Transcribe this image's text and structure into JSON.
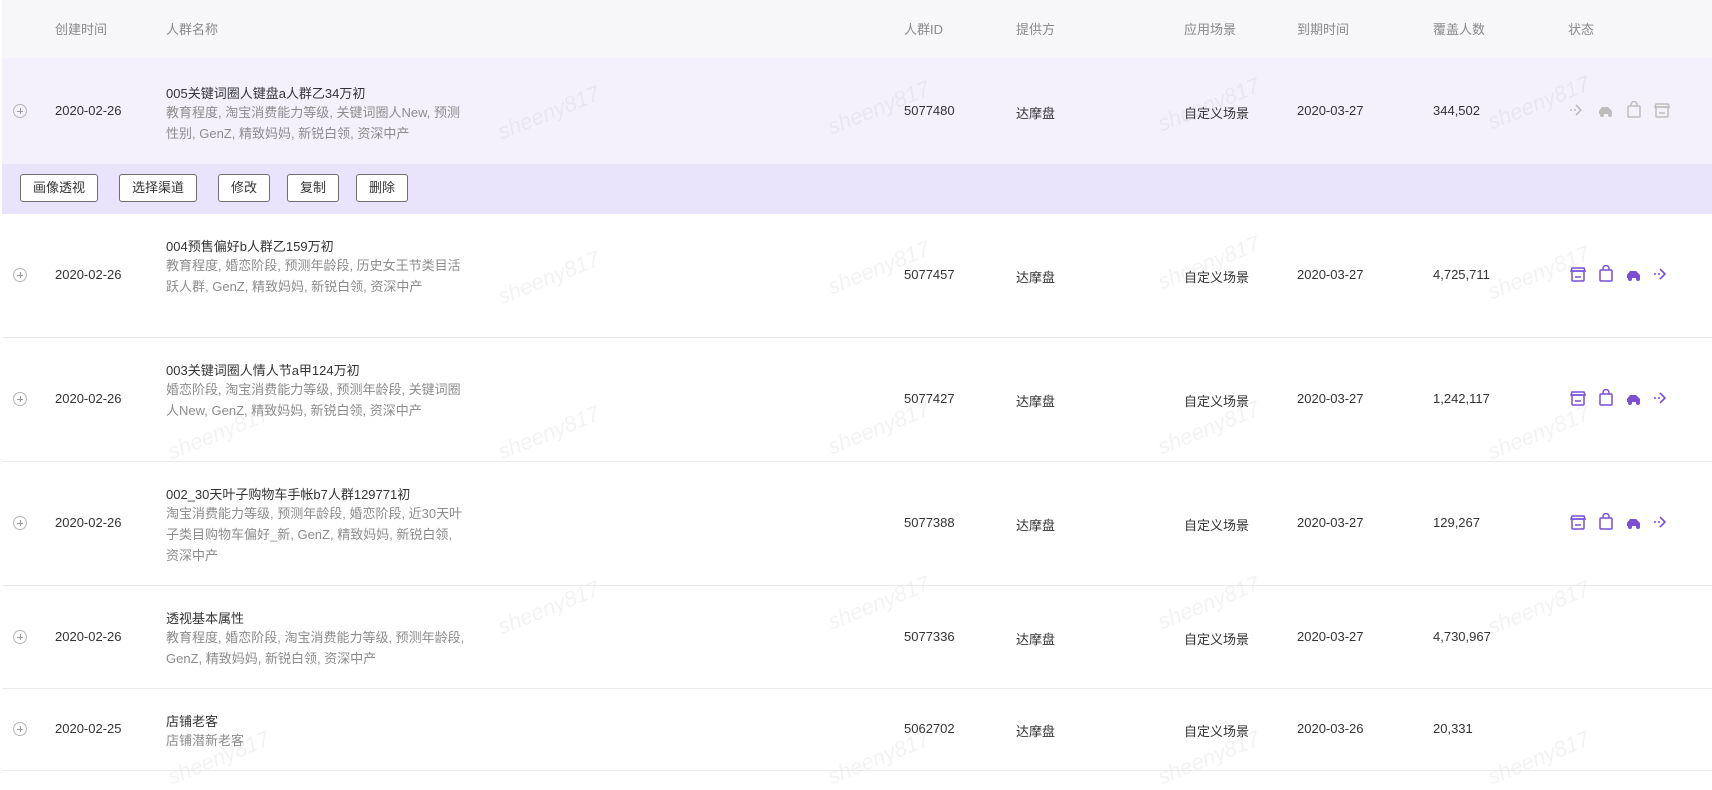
{
  "columns": [
    "创建时间",
    "人群名称",
    "人群ID",
    "提供方",
    "应用场景",
    "到期时间",
    "覆盖人数",
    "状态"
  ],
  "watermark": "sheeny817",
  "rows": [
    {
      "created": "2020-02-26",
      "title": "005关键词圈人键盘a人群乙34万初",
      "desc": "教育程度, 淘宝消费能力等级, 关键词圈人New, 预测性别, GenZ, 精致妈妈, 新锐白领, 资深中产",
      "id": "5077480",
      "provider": "达摩盘",
      "scene": "自定义场景",
      "expiry": "2020-03-27",
      "coverage": "344,502"
    },
    {
      "created": "2020-02-26",
      "title": "004预售偏好b人群乙159万初",
      "desc": "教育程度, 婚恋阶段, 预测年龄段, 历史女王节类目活跃人群, GenZ, 精致妈妈, 新锐白领, 资深中产",
      "id": "5077457",
      "provider": "达摩盘",
      "scene": "自定义场景",
      "expiry": "2020-03-27",
      "coverage": "4,725,711"
    },
    {
      "created": "2020-02-26",
      "title": "003关键词圈人情人节a甲124万初",
      "desc": "婚恋阶段, 淘宝消费能力等级, 预测年龄段, 关键词圈人New, GenZ, 精致妈妈, 新锐白领, 资深中产",
      "id": "5077427",
      "provider": "达摩盘",
      "scene": "自定义场景",
      "expiry": "2020-03-27",
      "coverage": "1,242,117"
    },
    {
      "created": "2020-02-26",
      "title": "002_30天叶子购物车手帐b7人群129771初",
      "desc": "淘宝消费能力等级, 预测年龄段, 婚恋阶段, 近30天叶子类目购物车偏好_新, GenZ, 精致妈妈, 新锐白领, 资深中产",
      "id": "5077388",
      "provider": "达摩盘",
      "scene": "自定义场景",
      "expiry": "2020-03-27",
      "coverage": "129,267"
    },
    {
      "created": "2020-02-26",
      "title": "透视基本属性",
      "desc": "教育程度, 婚恋阶段, 淘宝消费能力等级, 预测年龄段, GenZ, 精致妈妈, 新锐白领, 资深中产",
      "id": "5077336",
      "provider": "达摩盘",
      "scene": "自定义场景",
      "expiry": "2020-03-27",
      "coverage": "4,730,967"
    },
    {
      "created": "2020-02-25",
      "title": "店铺老客",
      "desc": "店铺潜新老客",
      "id": "5062702",
      "provider": "达摩盘",
      "scene": "自定义场景",
      "expiry": "2020-03-26",
      "coverage": "20,331"
    }
  ],
  "actions": [
    "画像透视",
    "选择渠道",
    "修改",
    "复制",
    "删除"
  ],
  "status_icons": {
    "row0": [
      "dispatch-arrow-icon",
      "car-icon",
      "shopping-bag-icon",
      "store-icon"
    ],
    "row1to3": [
      "store-icon",
      "shopping-bag-icon",
      "car-icon",
      "dispatch-arrow-icon"
    ]
  },
  "colors": {
    "accent": "#7a4fd6",
    "muted": "#bdbdbd",
    "header_bg": "#f7f7f9",
    "row_highlight": "#f4f1fd",
    "action_bar": "#e9e3fb"
  }
}
